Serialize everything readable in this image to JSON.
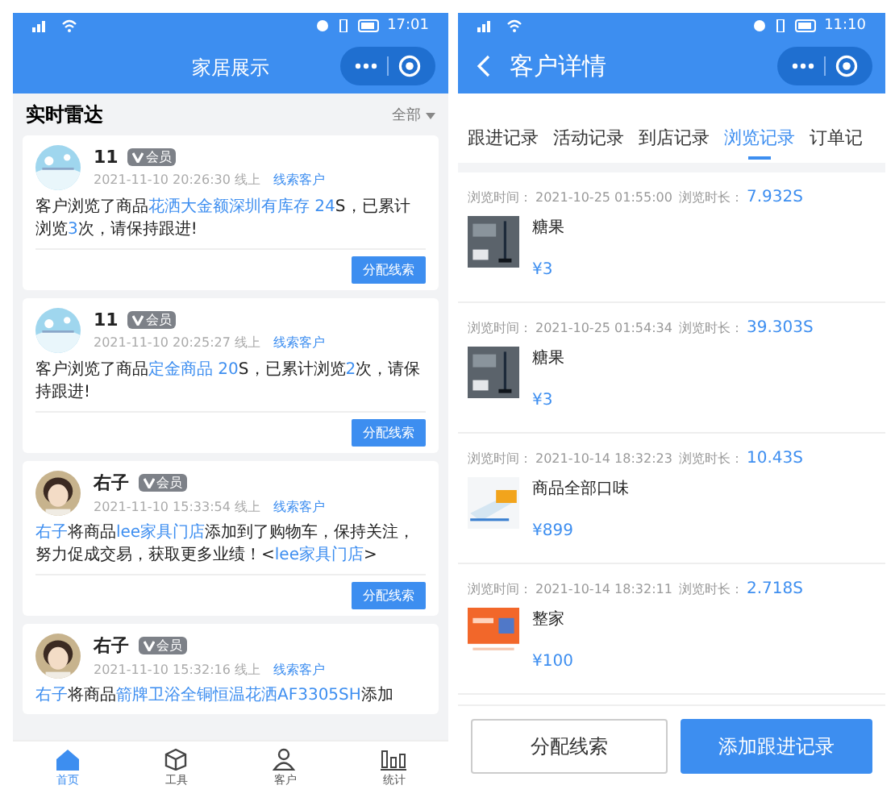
{
  "left_screen": {
    "status_bar": {
      "time": "17:01"
    },
    "nav": {
      "title": "家居展示"
    },
    "radar": {
      "title": "实时雷达",
      "filter": "全部"
    },
    "cards": [
      {
        "name": "11",
        "badge": "会员",
        "time": "2021-11-10 20:26:30 线上",
        "tag": "线索客户",
        "button": "分配线索",
        "message": [
          {
            "kind": "plain",
            "text": "客户浏览了商品"
          },
          {
            "kind": "link",
            "text": "花洒大金额深圳有库存 24"
          },
          {
            "kind": "plain",
            "text": "S，已累计浏览"
          },
          {
            "kind": "highlight",
            "text": "3"
          },
          {
            "kind": "plain",
            "text": "次，请保持跟进!"
          }
        ]
      },
      {
        "name": "11",
        "badge": "会员",
        "time": "2021-11-10 20:25:27 线上",
        "tag": "线索客户",
        "button": "分配线索",
        "message": [
          {
            "kind": "plain",
            "text": "客户浏览了商品"
          },
          {
            "kind": "link",
            "text": "定金商品 20"
          },
          {
            "kind": "plain",
            "text": "S，已累计浏览"
          },
          {
            "kind": "highlight",
            "text": "2"
          },
          {
            "kind": "plain",
            "text": "次，请保持跟进!"
          }
        ]
      },
      {
        "name": "右子",
        "badge": "会员",
        "time": "2021-11-10 15:33:54 线上",
        "tag": "线索客户",
        "button": "分配线索",
        "message": [
          {
            "kind": "link",
            "text": "右子"
          },
          {
            "kind": "plain",
            "text": "将商品"
          },
          {
            "kind": "link",
            "text": "lee家具门店"
          },
          {
            "kind": "plain",
            "text": "添加到了购物车，保持关注，努力促成交易，获取更多业绩！<"
          },
          {
            "kind": "link",
            "text": "lee家具门店"
          },
          {
            "kind": "plain",
            "text": ">"
          }
        ]
      },
      {
        "name": "右子",
        "badge": "会员",
        "time": "2021-11-10 15:32:16 线上",
        "tag": "线索客户",
        "message": [
          {
            "kind": "link",
            "text": "右子"
          },
          {
            "kind": "plain",
            "text": "将商品"
          },
          {
            "kind": "link",
            "text": "箭牌卫浴全铜恒温花洒AF3305SH"
          },
          {
            "kind": "plain",
            "text": "添加"
          }
        ]
      }
    ],
    "tab_bar": [
      {
        "label": "首页",
        "selected": true
      },
      {
        "label": "工具",
        "selected": false
      },
      {
        "label": "客户",
        "selected": false
      },
      {
        "label": "统计",
        "selected": false
      }
    ]
  },
  "right_screen": {
    "status_bar": {
      "time": "11:10"
    },
    "nav": {
      "title": "客户详情",
      "back": true
    },
    "tabs": [
      {
        "label": "跟进记录",
        "selected": false
      },
      {
        "label": "活动记录",
        "selected": false
      },
      {
        "label": "到店记录",
        "selected": false
      },
      {
        "label": "浏览记录",
        "selected": true
      },
      {
        "label": "订单记",
        "selected": false
      }
    ],
    "records": [
      {
        "time_label": "浏览时间：",
        "time": "2021-10-25 01:55:00",
        "duration_label": "浏览时长：",
        "duration": "7.932S",
        "product": "糖果",
        "price": "¥3"
      },
      {
        "time_label": "浏览时间：",
        "time": "2021-10-25 01:54:34",
        "duration_label": "浏览时长：",
        "duration": "39.303S",
        "product": "糖果",
        "price": "¥3"
      },
      {
        "time_label": "浏览时间：",
        "time": "2021-10-14 18:32:23",
        "duration_label": "浏览时长：",
        "duration": "10.43S",
        "product": "商品全部口味",
        "price": "¥899"
      },
      {
        "time_label": "浏览时间：",
        "time": "2021-10-14 18:32:11",
        "duration_label": "浏览时长：",
        "duration": "2.718S",
        "product": "整家",
        "price": "¥100"
      }
    ],
    "buttons": [
      {
        "label": "分配线索",
        "kind": "secondary"
      },
      {
        "label": "添加跟进记录",
        "kind": "primary"
      }
    ]
  }
}
